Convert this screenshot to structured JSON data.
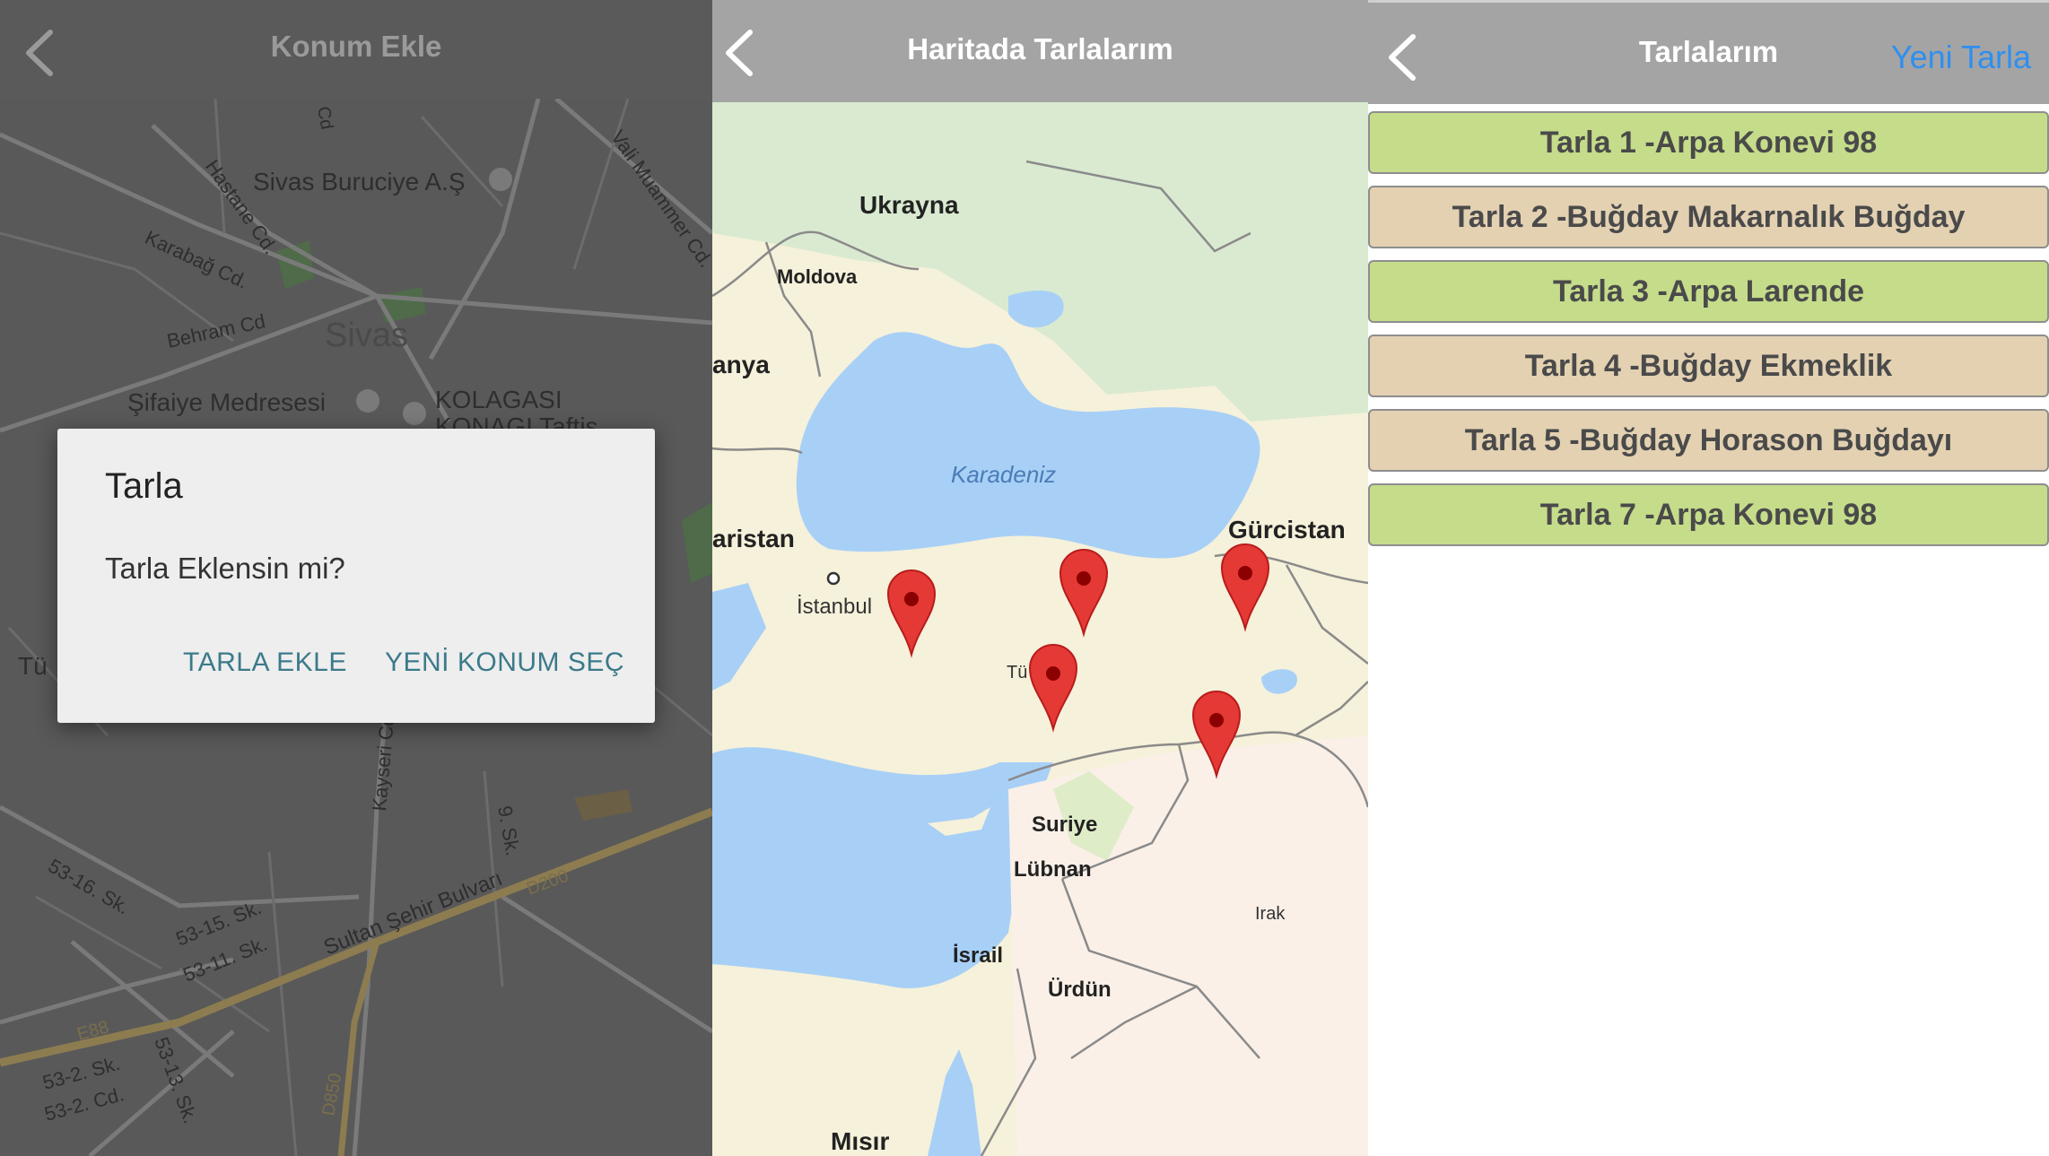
{
  "screen1": {
    "title": "Konum Ekle",
    "map_labels": {
      "poi_buruciye": "Sivas Buruciye A.Ş",
      "city": "Sivas",
      "poi_medrese": "Şifaiye Medresesi",
      "poi_konagi_1": "KOLAGASI",
      "poi_konagi_2": "KONAGI Taftis...",
      "street_hastane": "Hastane Cd.",
      "street_karabag": "Karabağ Cd.",
      "street_behram": "Behram Cd",
      "street_vali": "Vali Muammer Cd.",
      "street_kayseri": "Kayseri Cd",
      "street_9sk": "9. Sk.",
      "street_5316": "53-16. Sk.",
      "street_5315": "53-15. Sk.",
      "street_5311": "53-11. Sk.",
      "street_sultan": "Sultan Şehir Bulvarı",
      "street_532sk": "53-2. Sk.",
      "street_532cd": "53-2. Cd.",
      "street_5313": "53-13. Sk.",
      "road_d200": "D200",
      "road_e88": "E88",
      "road_d850": "D850",
      "edge_tu": "Tü",
      "edge_cd": "Cd"
    },
    "dialog": {
      "title": "Tarla",
      "message": "Tarla Eklensin mi?",
      "button_add": "TARLA EKLE",
      "button_new_location": "YENİ KONUM SEÇ"
    }
  },
  "screen2": {
    "title": "Haritada Tarlalarım",
    "map_labels": {
      "ukraine": "Ukrayna",
      "moldova": "Moldova",
      "romania_edge": "anya",
      "bulgaria_edge": "aristan",
      "black_sea": "Karadeniz",
      "georgia": "Gürcistan",
      "istanbul": "İstanbul",
      "turkey_edge": "Tü",
      "syria": "Suriye",
      "lebanon": "Lübnan",
      "iraq": "Irak",
      "israel": "İsrail",
      "jordan": "Ürdün",
      "egypt": "Mısır"
    }
  },
  "screen3": {
    "title": "Tarlalarım",
    "new_button": "Yeni Tarla",
    "fields": [
      {
        "label": "Tarla 1 -Arpa Konevi 98",
        "color": "#c5dc8a"
      },
      {
        "label": "Tarla 2 -Buğday Makarnalık Buğday",
        "color": "#e3d1b2"
      },
      {
        "label": "Tarla 3 -Arpa Larende",
        "color": "#c5dc8a"
      },
      {
        "label": "Tarla 4 -Buğday Ekmeklik",
        "color": "#e3d1b2"
      },
      {
        "label": "Tarla 5 -Buğday Horason Buğdayı",
        "color": "#e3d1b2"
      },
      {
        "label": "Tarla 7 -Arpa Konevi 98",
        "color": "#c5dc8a"
      }
    ]
  },
  "colors": {
    "nav_dark": "#5a5a5a",
    "nav_gray": "#a4a4a4",
    "dialog_button": "#3b7a8a",
    "link_blue": "#2f8ff0",
    "pin_red": "#e53935",
    "sea": "#a8d0f7",
    "land": "#f6f1da"
  }
}
